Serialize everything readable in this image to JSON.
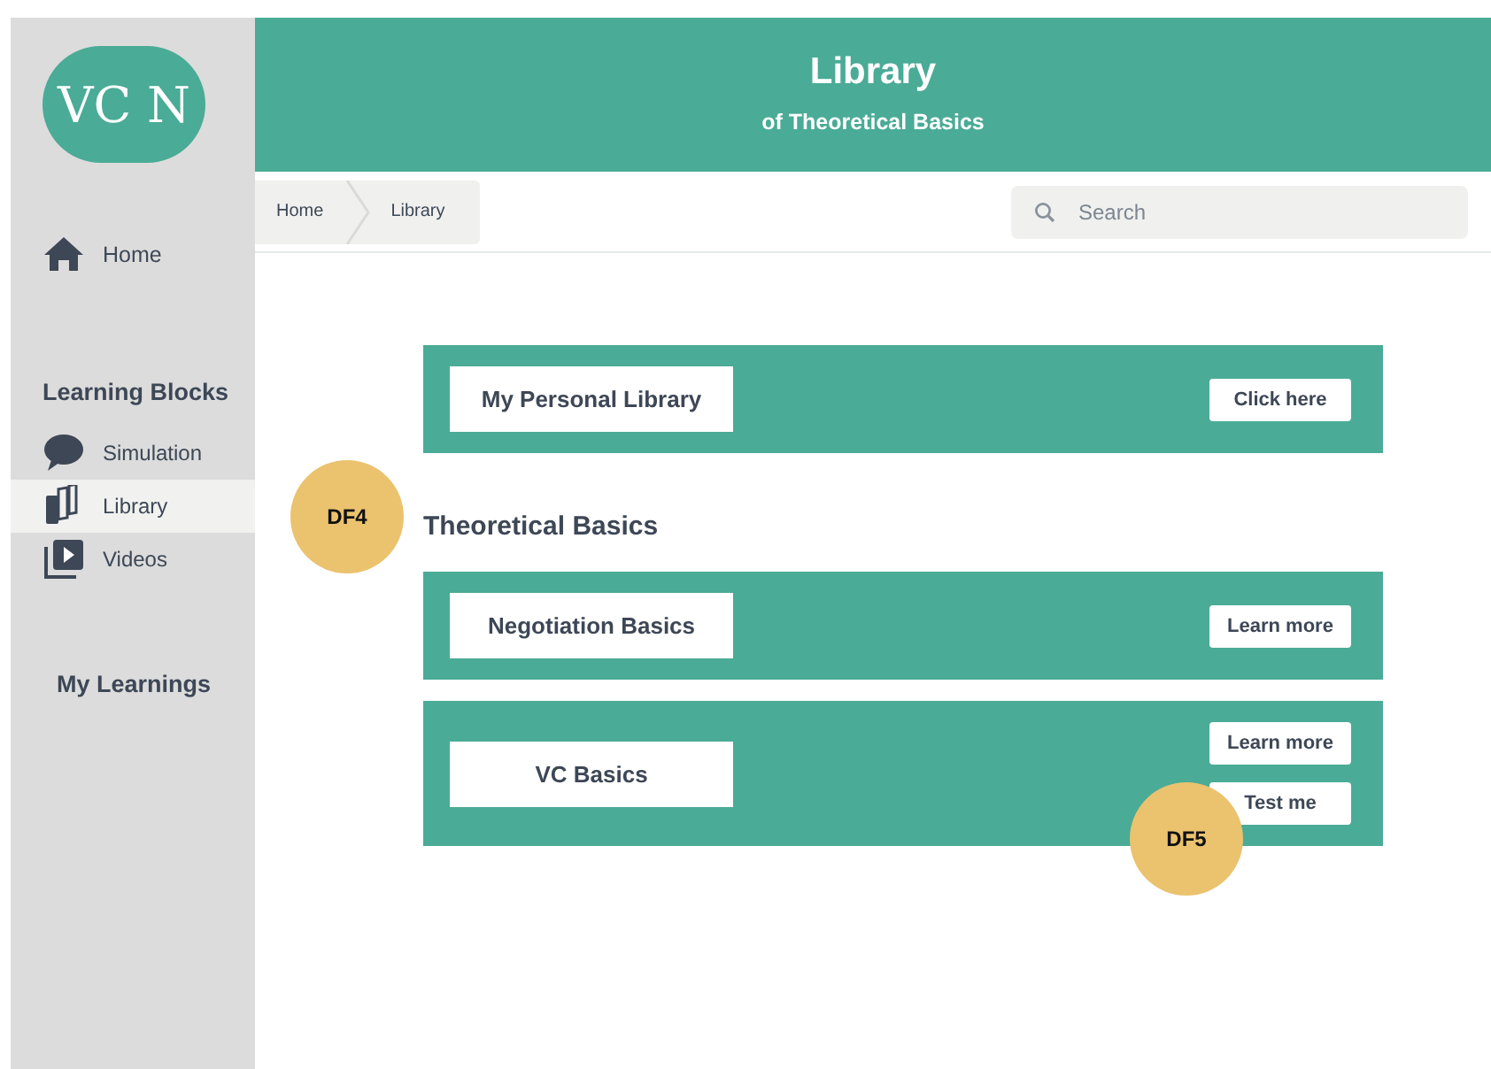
{
  "sidebar": {
    "logo": "VC N",
    "home": {
      "label": "Home",
      "selected": false
    },
    "sections": [
      {
        "title": "Learning Blocks",
        "items": [
          {
            "label": "Simulation",
            "selected": false
          },
          {
            "label": "Library",
            "selected": true
          },
          {
            "label": "Videos",
            "selected": false
          }
        ]
      },
      {
        "title": "My Learnings"
      }
    ]
  },
  "header": {
    "title": "Library",
    "subtitle": "of Theoretical Basics"
  },
  "breadcrumb": [
    {
      "label": "Home"
    },
    {
      "label": "Library"
    }
  ],
  "search": {
    "placeholder": "Search"
  },
  "featured": {
    "title": "My Personal Library",
    "buttons": [
      "Click here"
    ]
  },
  "section_title": "Theoretical Basics",
  "cards": [
    {
      "title": "Negotiation Basics",
      "buttons": [
        "Learn more"
      ]
    },
    {
      "title": "VC Basics",
      "buttons": [
        "Learn more",
        "Test me"
      ]
    }
  ],
  "annotations": [
    {
      "label": "DF4"
    },
    {
      "label": "DF5"
    }
  ]
}
